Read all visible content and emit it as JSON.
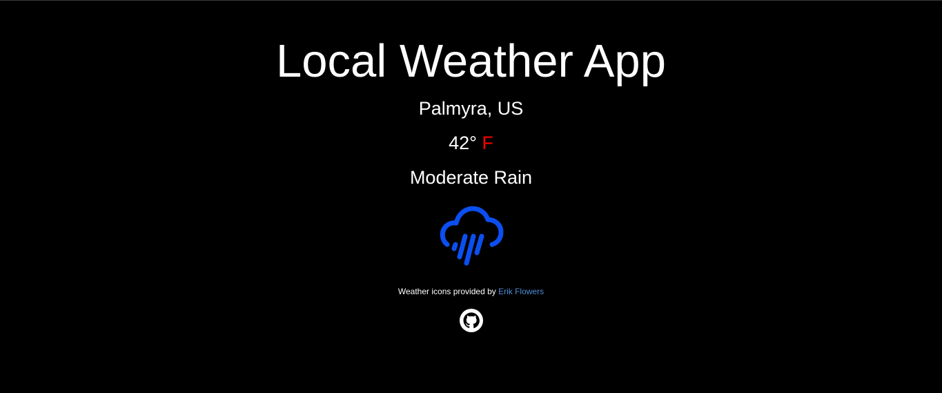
{
  "header": {
    "title": "Local Weather App"
  },
  "weather": {
    "location": "Palmyra, US",
    "temperature": "42°",
    "unit": "F",
    "condition": "Moderate Rain",
    "icon": "rain-cloud-icon"
  },
  "footer": {
    "credit_text": "Weather icons provided by",
    "credit_link": "Erik Flowers",
    "github_icon": "github-icon"
  },
  "colors": {
    "background": "#000000",
    "text": "#ffffff",
    "unit": "#ff0000",
    "icon": "#0b4ff0",
    "link": "#4f8ed6"
  }
}
